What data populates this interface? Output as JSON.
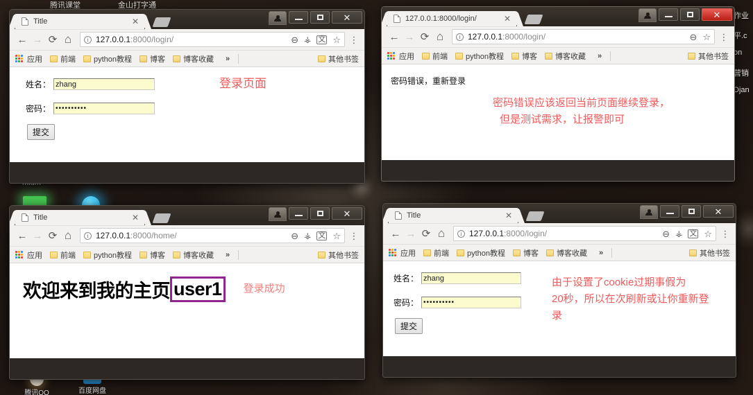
{
  "desktop": {
    "top_bar_items": [
      "腾讯课堂",
      "金山打字通"
    ],
    "right_edge_items": [
      "作业",
      "平.c",
      "on",
      "营销",
      "Djan"
    ],
    "faint_label": "mium",
    "icons": [
      {
        "label": "腾讯QQ",
        "color": "#f2f2f2"
      },
      {
        "label": "百度网盘",
        "color": "#2ea7f0"
      }
    ]
  },
  "bookmarks": {
    "apps_label": "应用",
    "items": [
      "前端",
      "python教程",
      "博客",
      "博客收藏"
    ],
    "overflow": "»",
    "other": "其他书签"
  },
  "nav": {
    "back": "←",
    "forward": "→",
    "reload": "⟳",
    "home": "⌂",
    "info": "i",
    "zoom_out": "⊖",
    "key": "⚷",
    "translate": "ἱ0",
    "star": "☆",
    "menu": "⋮"
  },
  "windows": [
    {
      "id": "login-form-window",
      "active": false,
      "close_red": false,
      "tab_title": "Title",
      "url_host": "127.0.0.1",
      "url_path": ":8000/login/",
      "omni_icons": [
        "zoom-out",
        "key",
        "translate",
        "star"
      ],
      "page": {
        "kind": "login-form",
        "name_label": "姓名：",
        "name_value": "zhang",
        "password_label": "密码：",
        "password_value": "••••••••••",
        "submit_label": "提交",
        "annotation": "登录页面"
      }
    },
    {
      "id": "password-error-window",
      "active": true,
      "close_red": true,
      "tab_title": "127.0.0.1:8000/login/",
      "url_host": "127.0.0.1",
      "url_path": ":8000/login/",
      "omni_icons": [
        "zoom-out",
        "star"
      ],
      "page": {
        "kind": "error-message",
        "message": "密码错误，重新登录",
        "annotation_line1": "密码错误应该返回当前页面继续登录，",
        "annotation_line2": "但是测试需求，让报警即可"
      }
    },
    {
      "id": "home-page-window",
      "active": false,
      "close_red": false,
      "tab_title": "Title",
      "url_host": "127.0.0.1",
      "url_path": ":8000/home/",
      "omni_icons": [
        "zoom-out",
        "key",
        "translate",
        "star"
      ],
      "page": {
        "kind": "home",
        "heading_prefix": "欢迎来到我的主页",
        "heading_user": "user1",
        "annotation": "登录成功",
        "user_box_color": "#8e268e"
      }
    },
    {
      "id": "relogin-window",
      "active": false,
      "close_red": false,
      "tab_title": "Title",
      "url_host": "127.0.0.1",
      "url_path": ":8000/login/",
      "omni_icons": [
        "zoom-out",
        "key",
        "translate",
        "star"
      ],
      "page": {
        "kind": "login-form",
        "name_label": "姓名：",
        "name_value": "zhang",
        "password_label": "密码：",
        "password_value": "••••••••••",
        "submit_label": "提交",
        "annotation_line1": "由于设置了cookie过期事假为",
        "annotation_line2": "20秒，所以在次刷新或让你重新登",
        "annotation_line3": "录"
      }
    }
  ],
  "colors": {
    "annotation_red": "#f05a5a",
    "autofill_yellow": "#fbfbcd",
    "tab_bg": "#f2f1f0",
    "titlebar_dark": "#2d2823"
  }
}
